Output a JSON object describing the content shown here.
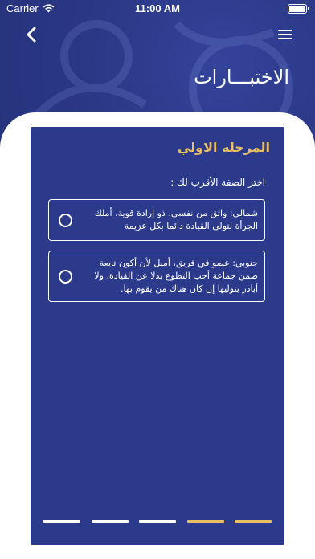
{
  "status_bar": {
    "carrier": "Carrier",
    "time": "11:00 AM"
  },
  "header": {
    "title": "الاختبـــارات"
  },
  "card": {
    "stage_title": "المرحله الاولي",
    "question": "اختر الصفة الأقرب لك :",
    "options": [
      {
        "text": "شمالي: واثق من نفسي، ذو إرادة قوية، أملك الجرأة لتولي القيادة دائما بكل عزيمة",
        "selected": false
      },
      {
        "text": "جنوبي: عضو في فريق، أميل لأن أكون تابعة ضمن جماعة أحب التطوع بدلا عن القيادة، ولا أبادر بتوليها إن كان هناك من يقوم بها.",
        "selected": false
      }
    ]
  },
  "progress": {
    "total_steps": 5,
    "completed_steps": 2,
    "colors": {
      "completed": "#e8c064",
      "pending": "#ffffff"
    }
  },
  "colors": {
    "primary": "#2c3a8c",
    "accent": "#e8c064",
    "sheet": "#ffffff"
  }
}
